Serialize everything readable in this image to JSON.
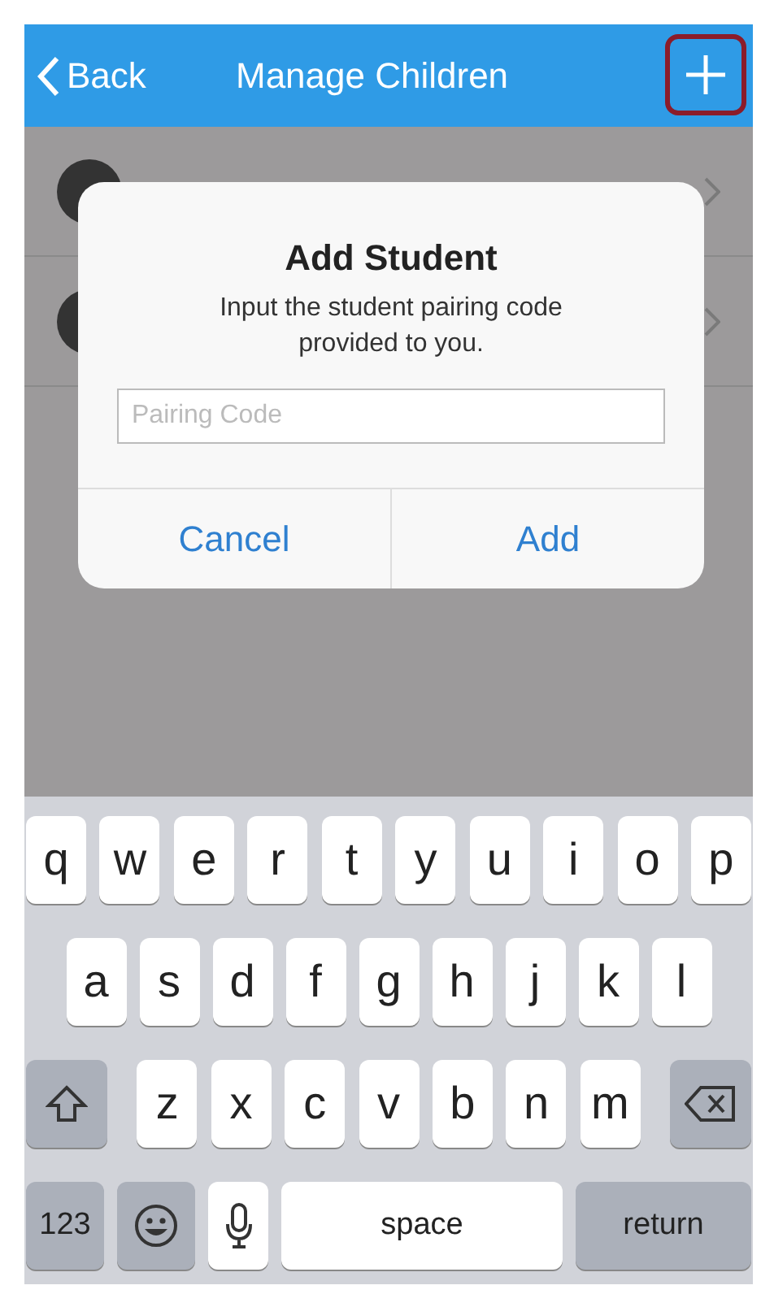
{
  "nav_bar": {
    "back_label": "Back",
    "title": "Manage Children",
    "add_highlighted": true
  },
  "list_rows": [
    {
      "kind": "student"
    },
    {
      "kind": "student"
    }
  ],
  "dialog": {
    "title": "Add Student",
    "message": "Input the student pairing code provided to you.",
    "field": {
      "placeholder": "Pairing Code"
    },
    "buttons": [
      "Cancel",
      "Add"
    ]
  },
  "keyboard": {
    "rows": [
      [
        {
          "kind": "letter",
          "label": "q"
        },
        {
          "kind": "letter",
          "label": "w"
        },
        {
          "kind": "letter",
          "label": "e"
        },
        {
          "kind": "letter",
          "label": "r"
        },
        {
          "kind": "letter",
          "label": "t"
        },
        {
          "kind": "letter",
          "label": "y"
        },
        {
          "kind": "letter",
          "label": "u"
        },
        {
          "kind": "letter",
          "label": "i"
        },
        {
          "kind": "letter",
          "label": "o"
        },
        {
          "kind": "letter",
          "label": "p"
        }
      ],
      [
        {
          "kind": "letter",
          "label": "a"
        },
        {
          "kind": "letter",
          "label": "s"
        },
        {
          "kind": "letter",
          "label": "d"
        },
        {
          "kind": "letter",
          "label": "f"
        },
        {
          "kind": "letter",
          "label": "g"
        },
        {
          "kind": "letter",
          "label": "h"
        },
        {
          "kind": "letter",
          "label": "j"
        },
        {
          "kind": "letter",
          "label": "k"
        },
        {
          "kind": "letter",
          "label": "l"
        }
      ],
      [
        {
          "kind": "shift"
        },
        {
          "kind": "letter",
          "label": "z"
        },
        {
          "kind": "letter",
          "label": "x"
        },
        {
          "kind": "letter",
          "label": "c"
        },
        {
          "kind": "letter",
          "label": "v"
        },
        {
          "kind": "letter",
          "label": "b"
        },
        {
          "kind": "letter",
          "label": "n"
        },
        {
          "kind": "letter",
          "label": "m"
        },
        {
          "kind": "delete"
        }
      ]
    ],
    "bottom_row": [
      {
        "kind": "numbers",
        "label": "123"
      },
      {
        "kind": "emoji"
      },
      {
        "kind": "mic"
      },
      {
        "kind": "space",
        "label": "space"
      },
      {
        "kind": "return",
        "label": "return"
      }
    ]
  }
}
